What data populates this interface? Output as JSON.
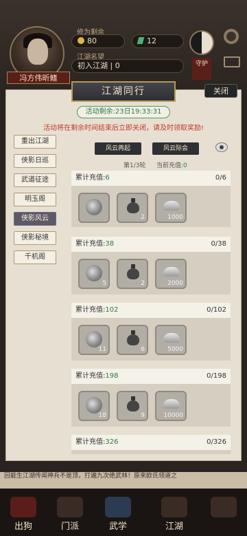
{
  "player": {
    "name": "冯方伟昕鳍",
    "stat1_label": "修为剩余",
    "stat1_value": "80",
    "stat2_value": "12",
    "stat3_label": "江湖名望",
    "stat3_value": "初入江湖",
    "stat3_num": "0",
    "sect": "守护"
  },
  "panel": {
    "title": "江湖同行",
    "close_label": "关闭",
    "remaining_label": "活动剩余:",
    "remaining_time": "23日19:33:31",
    "warning": "活动将在剩余时间结束后立即关闭，请及时领取奖励!"
  },
  "side_tabs": [
    {
      "label": "重出江湖",
      "active": false
    },
    {
      "label": "侠影日巡",
      "active": false
    },
    {
      "label": "武道征途",
      "active": false
    },
    {
      "label": "明玉阁",
      "active": false
    },
    {
      "label": "侠影风云",
      "active": true
    },
    {
      "label": "侠影秘境",
      "active": false
    },
    {
      "label": "千机阁",
      "active": false
    }
  ],
  "sub_tabs": [
    "风云再起",
    "风云际会"
  ],
  "round": {
    "round_text": "第1/3轮",
    "current_label": "当前充值:",
    "current_value": "0"
  },
  "rewards": [
    {
      "label": "累计充值:",
      "amount": "6",
      "progress": "0/6",
      "qty": [
        "",
        "2",
        "1000"
      ]
    },
    {
      "label": "累计充值:",
      "amount": "38",
      "progress": "0/38",
      "qty": [
        "5",
        "2",
        "2000"
      ]
    },
    {
      "label": "累计充值:",
      "amount": "102",
      "progress": "0/102",
      "qty": [
        "11",
        "6",
        "5000"
      ]
    },
    {
      "label": "累计充值:",
      "amount": "198",
      "progress": "0/198",
      "qty": [
        "18",
        "9",
        "10000"
      ]
    },
    {
      "label": "累计充值:",
      "amount": "326",
      "progress": "0/326",
      "qty": []
    }
  ],
  "bottom_text": "回能生江湖传闻神兵不是顶，打遍九次绝武林！原来欧氏领道之",
  "nav": [
    "出狗",
    "门派",
    "武学",
    "",
    "江湖",
    ""
  ]
}
